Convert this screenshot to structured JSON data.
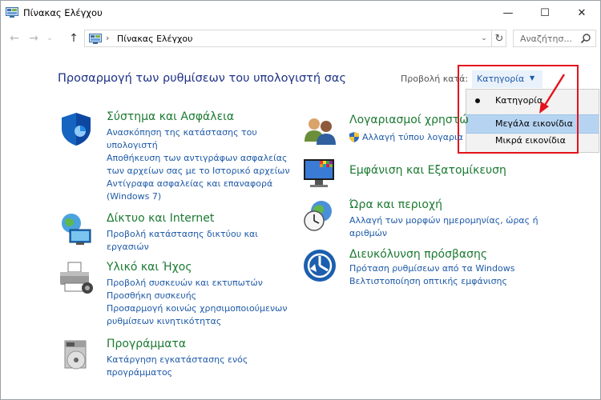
{
  "window": {
    "title": "Πίνακας Ελέγχου",
    "controls": {
      "minimize": "—",
      "maximize": "☐",
      "close": "✕"
    }
  },
  "nav": {
    "back_icon": "back-arrow-icon",
    "forward_icon": "forward-arrow-icon",
    "up_icon": "up-arrow-icon",
    "address": "Πίνακας Ελέγχου",
    "address_sep": "›",
    "search_placeholder": "Αναζήτησ..."
  },
  "header": {
    "title": "Προσαρμογή των ρυθμίσεων του υπολογιστή σας",
    "view_by_label": "Προβολή κατά:",
    "view_by_value": "Κατηγορία"
  },
  "view_menu": {
    "items": [
      {
        "label": "Κατηγορία",
        "selected": true
      },
      {
        "label": "Μεγάλα εικονίδια",
        "highlighted": true
      },
      {
        "label": "Μικρά εικονίδια"
      }
    ]
  },
  "annotation": {
    "color": "#e3131b"
  },
  "categories": {
    "system": {
      "title": "Σύστημα και Ασφάλεια",
      "links": [
        "Ανασκόπηση της κατάστασης του",
        "υπολογιστή",
        "Αποθήκευση των αντιγράφων ασφαλείας",
        "των αρχείων σας με το Ιστορικό αρχείων",
        "Αντίγραφα ασφαλείας και επαναφορά",
        "(Windows 7)"
      ]
    },
    "network": {
      "title": "Δίκτυο και Internet",
      "links": [
        "Προβολή κατάστασης δικτύου και",
        "εργασιών"
      ]
    },
    "hardware": {
      "title": "Υλικό και Ήχος",
      "links": [
        "Προβολή συσκευών και εκτυπωτών",
        "Προσθήκη συσκευής",
        "Προσαρμογή κοινώς χρησιμοποιούμενων",
        "ρυθμίσεων κινητικότητας"
      ]
    },
    "programs": {
      "title": "Προγράμματα",
      "links": [
        "Κατάργηση εγκατάστασης ενός",
        "προγράμματος"
      ]
    },
    "accounts": {
      "title": "Λογαριασμοί χρηστώ",
      "links": [
        "Αλλαγή τύπου λογαρια"
      ]
    },
    "appearance": {
      "title": "Εμφάνιση και Εξατομίκευση"
    },
    "clock": {
      "title": "Ώρα και περιοχή",
      "links": [
        "Αλλαγή των μορφών ημερομηνίας, ώρας ή",
        "αριθμών"
      ]
    },
    "ease": {
      "title": "Διευκόλυνση πρόσβασης",
      "links": [
        "Πρόταση ρυθμίσεων από τα Windows",
        "Βελτιστοποίηση οπτικής εμφάνισης"
      ]
    }
  },
  "colors": {
    "heading": "#1e3287",
    "category": "#1c7a32",
    "link": "#1e5aa8",
    "highlight": "#b6d4f2"
  }
}
